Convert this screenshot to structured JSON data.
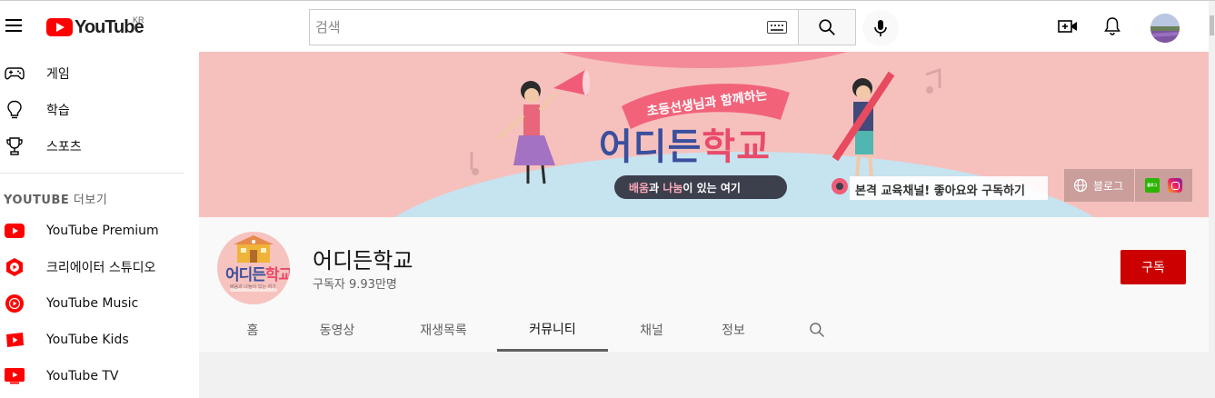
{
  "header": {
    "logo_text": "YouTube",
    "logo_region": "KR",
    "search_placeholder": "검색"
  },
  "sidebar": {
    "items": [
      {
        "label": "게임",
        "icon": "gamepad-icon"
      },
      {
        "label": "학습",
        "icon": "lightbulb-icon"
      },
      {
        "label": "스포츠",
        "icon": "trophy-icon"
      }
    ],
    "section_title_bold": "YOUTUBE",
    "section_title_rest": " 더보기",
    "more_items": [
      {
        "label": "YouTube Premium",
        "icon": "youtube-premium-icon"
      },
      {
        "label": "크리에이터 스튜디오",
        "icon": "youtube-studio-icon"
      },
      {
        "label": "YouTube Music",
        "icon": "youtube-music-icon"
      },
      {
        "label": "YouTube Kids",
        "icon": "youtube-kids-icon"
      },
      {
        "label": "YouTube TV",
        "icon": "youtube-tv-icon"
      }
    ]
  },
  "banner": {
    "subtitle": "초등선생님과 함께하는",
    "title_part1": "어디든",
    "title_part2": "학교",
    "pill_part1": "배움",
    "pill_mid": "과 ",
    "pill_part2": "나눔",
    "pill_rest": "이 있는 여기",
    "tagline": "본격 교육채널! 좋아요와 구독하기",
    "link_label": "블로그",
    "link_naver_label": "블로그"
  },
  "channel": {
    "name": "어디든학교",
    "subscribers": "구독자 9.93만명",
    "subscribe_label": "구독",
    "avatar_text_part1": "어디든",
    "avatar_text_part2": "학교",
    "avatar_caption": "배움과 나눔이 있는 여기"
  },
  "tabs": [
    {
      "label": "홈"
    },
    {
      "label": "동영상"
    },
    {
      "label": "재생목록"
    },
    {
      "label": "커뮤니티",
      "active": true
    },
    {
      "label": "채널"
    },
    {
      "label": "정보"
    }
  ],
  "colors": {
    "brand_red": "#ff0000",
    "subscribe_red": "#cc0000",
    "banner_bg": "#f6c1bd"
  }
}
